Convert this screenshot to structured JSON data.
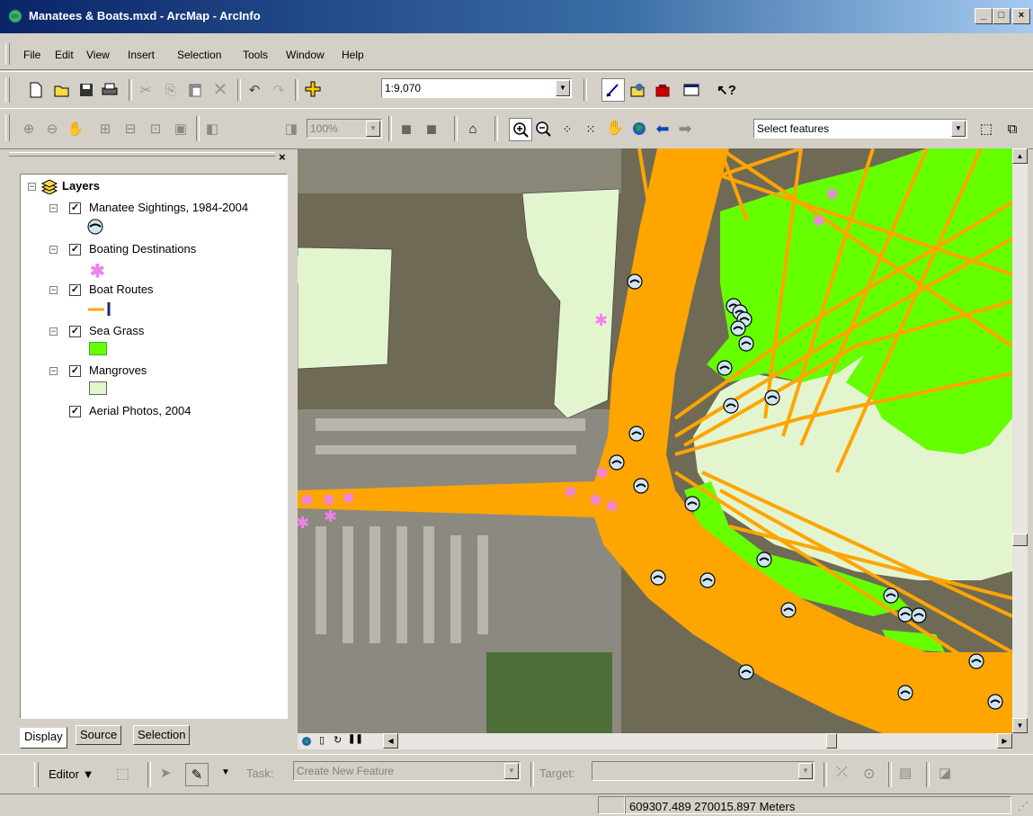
{
  "window": {
    "title": "Manatees & Boats.mxd - ArcMap - ArcInfo",
    "minimize": "_",
    "maximize": "□",
    "close": "×"
  },
  "menu": {
    "items": [
      "File",
      "Edit",
      "View",
      "Insert",
      "Selection",
      "Tools",
      "Window",
      "Help"
    ]
  },
  "standard_toolbar": {
    "scale": "1:9,070"
  },
  "tools_toolbar": {
    "zoom_percent": "100%",
    "select_tool": "Select features"
  },
  "toc": {
    "close": "×",
    "root": "Layers",
    "layers": [
      {
        "name": "Manatee Sightings, 1984-2004",
        "checked": true,
        "symbol": "manatee-icon"
      },
      {
        "name": "Boating Destinations",
        "checked": true,
        "symbol": "asterisk",
        "color": "#ee82ee"
      },
      {
        "name": "Boat Routes",
        "checked": true,
        "symbol": "line",
        "color": "#ffa500"
      },
      {
        "name": "Sea Grass",
        "checked": true,
        "symbol": "fill",
        "color": "#66ff00"
      },
      {
        "name": "Mangroves",
        "checked": true,
        "symbol": "fill",
        "color": "#e3f5cf"
      },
      {
        "name": "Aerial Photos, 2004",
        "checked": true,
        "symbol": "none"
      }
    ],
    "tabs": [
      "Display",
      "Source",
      "Selection"
    ]
  },
  "editor_toolbar": {
    "editor_label": "Editor",
    "task_label": "Task:",
    "task_value": "Create New Feature",
    "target_label": "Target:",
    "target_value": ""
  },
  "status": {
    "coordinates": "609307.489  270015.897 Meters"
  },
  "colors": {
    "routes": "#ffa500",
    "seagrass": "#66ff00",
    "mangroves": "#e3f5cf",
    "destinations": "#ee82ee",
    "titlebar": "#0a246a"
  }
}
